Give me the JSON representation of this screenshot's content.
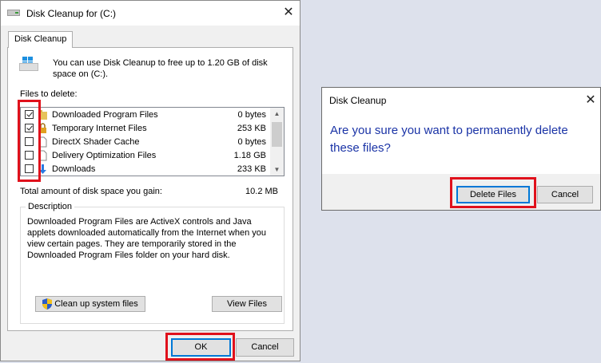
{
  "main_window": {
    "title": "Disk Cleanup for  (C:)",
    "tab_label": "Disk Cleanup",
    "intro_text": "You can use Disk Cleanup to free up to 1.20 GB of disk space on  (C:).",
    "files_label": "Files to delete:",
    "files": [
      {
        "name": "Downloaded Program Files",
        "size": "0 bytes",
        "checked": true,
        "icon": "folder-lock-icon"
      },
      {
        "name": "Temporary Internet Files",
        "size": "253 KB",
        "checked": true,
        "icon": "lock-icon"
      },
      {
        "name": "DirectX Shader Cache",
        "size": "0 bytes",
        "checked": false,
        "icon": "file-icon"
      },
      {
        "name": "Delivery Optimization Files",
        "size": "1.18 GB",
        "checked": false,
        "icon": "file-icon"
      },
      {
        "name": "Downloads",
        "size": "233 KB",
        "checked": false,
        "icon": "download-arrow-icon"
      }
    ],
    "total_label": "Total amount of disk space you gain:",
    "total_value": "10.2 MB",
    "description_label": "Description",
    "description_text": "Downloaded Program Files are ActiveX controls and Java applets downloaded automatically from the Internet when you view certain pages. They are temporarily stored in the Downloaded Program Files folder on your hard disk.",
    "cleanup_system_button": "Clean up system files",
    "view_files_button": "View Files",
    "ok_button": "OK",
    "cancel_button": "Cancel"
  },
  "confirm_dialog": {
    "title": "Disk Cleanup",
    "message": "Are you sure you want to permanently delete these files?",
    "delete_button": "Delete Files",
    "cancel_button": "Cancel"
  },
  "colors": {
    "highlight": "#e0111c",
    "message_blue": "#1a33a6",
    "default_button_border": "#0078d7"
  }
}
